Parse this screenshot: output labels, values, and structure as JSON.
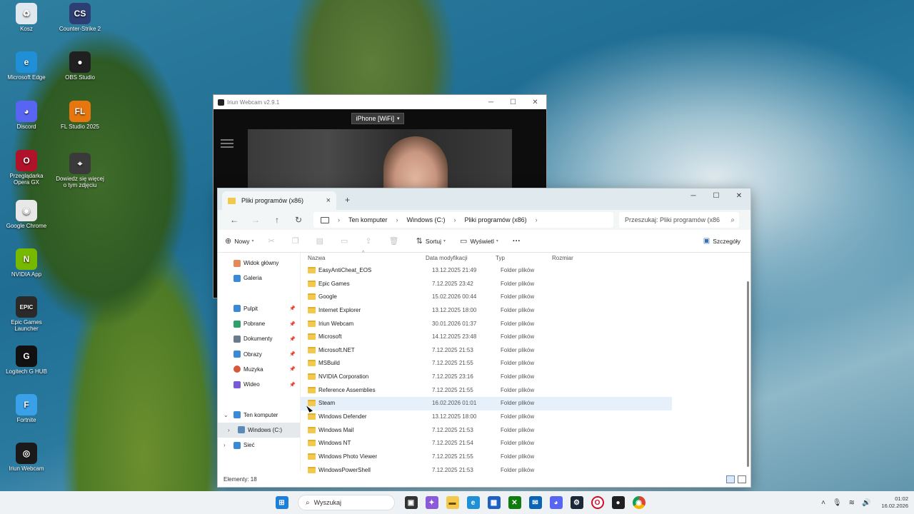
{
  "desktop_icons": [
    {
      "label": "Kosz",
      "color": "#dfe8ee",
      "glyph": "♻"
    },
    {
      "label": "Counter-Strike 2",
      "color": "#2c3e73",
      "glyph": "CS"
    },
    {
      "label": "Microsoft Edge",
      "color": "#1f8fd6",
      "glyph": "e"
    },
    {
      "label": "OBS Studio",
      "color": "#202020",
      "glyph": "●"
    },
    {
      "label": "Discord",
      "color": "#5865f2",
      "glyph": "◕"
    },
    {
      "label": "FL Studio 2025",
      "color": "#e8760e",
      "glyph": "FL"
    },
    {
      "label": "Przeglądarka Opera GX",
      "color": "#b0122a",
      "glyph": "O"
    },
    {
      "label": "Dowiedz się więcej o tym zdjęciu",
      "color": "#3a3a3a",
      "glyph": "⌖"
    },
    {
      "label": "Google Chrome",
      "color": "#e8e8e8",
      "glyph": "◉"
    },
    {
      "label": "NVIDIA App",
      "color": "#76b900",
      "glyph": "N"
    },
    {
      "label": "Epic Games Launcher",
      "color": "#2a2a2a",
      "glyph": "EPIC"
    },
    {
      "label": "Logitech G HUB",
      "color": "#111111",
      "glyph": "G"
    },
    {
      "label": "Fortnite",
      "color": "#3aa0e8",
      "glyph": "F"
    },
    {
      "label": "Iriun Webcam",
      "color": "#1a1a1a",
      "glyph": "◎"
    }
  ],
  "webcam": {
    "title": "Iriun Webcam v2.9.1",
    "device_select": "iPhone [WiFi]"
  },
  "explorer": {
    "tab_title": "Pliki programów (x86)",
    "tab_close": "×",
    "tab_add": "+",
    "breadcrumb": [
      "Ten komputer",
      "Windows (C:)",
      "Pliki programów (x86)"
    ],
    "search_placeholder": "Przeszukaj: Pliki programów (x86",
    "commands": {
      "new": "Nowy",
      "sort": "Sortuj",
      "view": "Wyświetl",
      "more": "···",
      "details": "Szczegóły"
    },
    "nav": {
      "home": "Widok główny",
      "gallery": "Galeria",
      "desktop": "Pulpit",
      "downloads": "Pobrane",
      "documents": "Dokumenty",
      "pictures": "Obrazy",
      "music": "Muzyka",
      "videos": "Wideo",
      "this_pc": "Ten komputer",
      "drive_c": "Windows (C:)",
      "network": "Sieć"
    },
    "columns": {
      "name": "Nazwa",
      "modified": "Data modyfikacji",
      "type": "Typ",
      "size": "Rozmiar"
    },
    "files": [
      {
        "name": "EasyAntiCheat_EOS",
        "date": "13.12.2025 21:49",
        "type": "Folder plików"
      },
      {
        "name": "Epic Games",
        "date": "7.12.2025 23:42",
        "type": "Folder plików"
      },
      {
        "name": "Google",
        "date": "15.02.2026 00:44",
        "type": "Folder plików"
      },
      {
        "name": "Internet Explorer",
        "date": "13.12.2025 18:00",
        "type": "Folder plików"
      },
      {
        "name": "Iriun Webcam",
        "date": "30.01.2026 01:37",
        "type": "Folder plików"
      },
      {
        "name": "Microsoft",
        "date": "14.12.2025 23:48",
        "type": "Folder plików"
      },
      {
        "name": "Microsoft.NET",
        "date": "7.12.2025 21:53",
        "type": "Folder plików"
      },
      {
        "name": "MSBuild",
        "date": "7.12.2025 21:55",
        "type": "Folder plików"
      },
      {
        "name": "NVIDIA Corporation",
        "date": "7.12.2025 23:16",
        "type": "Folder plików"
      },
      {
        "name": "Reference Assemblies",
        "date": "7.12.2025 21:55",
        "type": "Folder plików"
      },
      {
        "name": "Steam",
        "date": "16.02.2026 01:01",
        "type": "Folder plików",
        "selected": true
      },
      {
        "name": "Windows Defender",
        "date": "13.12.2025 18:00",
        "type": "Folder plików"
      },
      {
        "name": "Windows Mail",
        "date": "7.12.2025 21:53",
        "type": "Folder plików"
      },
      {
        "name": "Windows NT",
        "date": "7.12.2025 21:54",
        "type": "Folder plików"
      },
      {
        "name": "Windows Photo Viewer",
        "date": "7.12.2025 21:55",
        "type": "Folder plików"
      },
      {
        "name": "WindowsPowerShell",
        "date": "7.12.2025 21:53",
        "type": "Folder plików"
      }
    ],
    "status": "Elementy: 18"
  },
  "taskbar": {
    "search_label": "Wyszukaj",
    "time": "01:02",
    "date": "16.02.2026"
  }
}
